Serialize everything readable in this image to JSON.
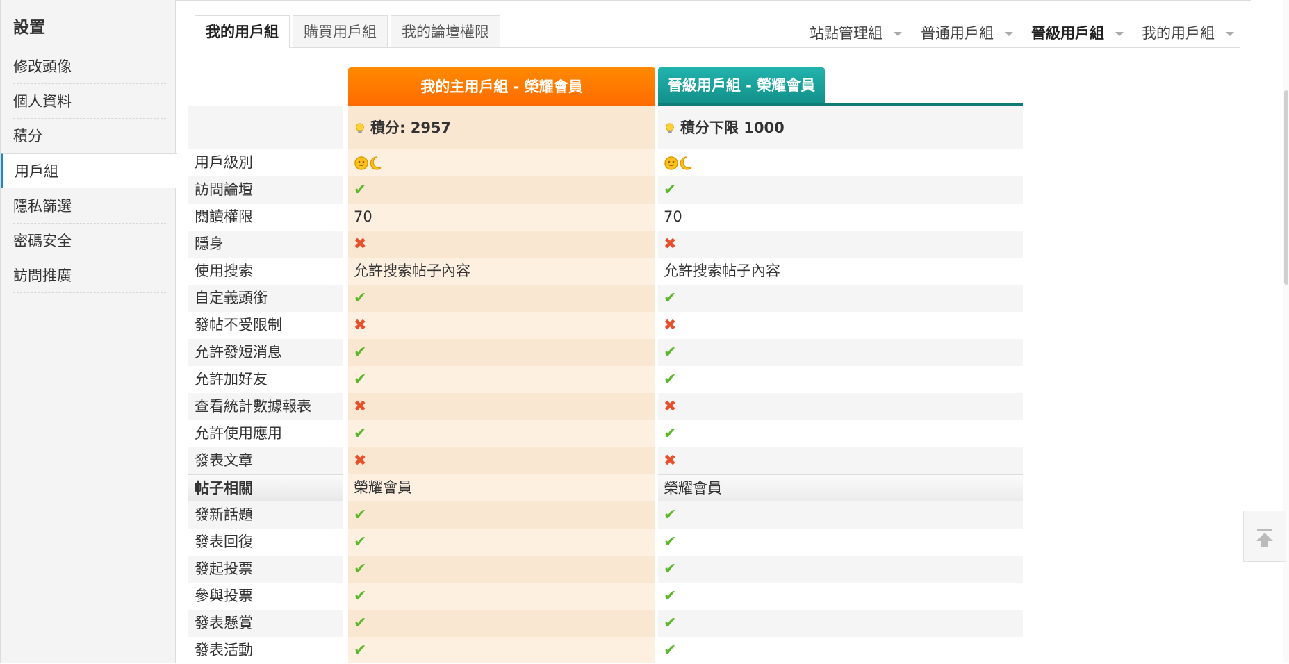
{
  "sidebar": {
    "title": "設置",
    "items": [
      {
        "label": "修改頭像"
      },
      {
        "label": "個人資料"
      },
      {
        "label": "積分"
      },
      {
        "label": "用戶組"
      },
      {
        "label": "隱私篩選"
      },
      {
        "label": "密碼安全"
      },
      {
        "label": "訪問推廣"
      }
    ]
  },
  "tabs": [
    {
      "label": "我的用戶組"
    },
    {
      "label": "購買用戶組"
    },
    {
      "label": "我的論壇權限"
    }
  ],
  "top_links": [
    {
      "label": "站點管理組"
    },
    {
      "label": "普通用戶組"
    },
    {
      "label": "晉級用戶組"
    },
    {
      "label": "我的用戶組"
    }
  ],
  "table": {
    "main_header": "我的主用戶組 - 榮耀會員",
    "alt_header": "晉級用戶組 - 榮耀會員",
    "main_score": "積分: 2957",
    "alt_score": "積分下限 1000",
    "rows": [
      {
        "label": "用戶級別",
        "c1": "icons",
        "c2": "icons"
      },
      {
        "label": "訪問論壇",
        "c1": "yes",
        "c2": "yes"
      },
      {
        "label": "閱讀權限",
        "c1": "70",
        "c2": "70"
      },
      {
        "label": "隱身",
        "c1": "no",
        "c2": "no"
      },
      {
        "label": "使用搜索",
        "c1": "允許搜索帖子內容",
        "c2": "允許搜索帖子內容"
      },
      {
        "label": "自定義頭銜",
        "c1": "yes",
        "c2": "yes"
      },
      {
        "label": "發帖不受限制",
        "c1": "no",
        "c2": "no"
      },
      {
        "label": "允許發短消息",
        "c1": "yes",
        "c2": "yes"
      },
      {
        "label": "允許加好友",
        "c1": "yes",
        "c2": "yes"
      },
      {
        "label": "查看統計數據報表",
        "c1": "no",
        "c2": "no"
      },
      {
        "label": "允許使用應用",
        "c1": "yes",
        "c2": "yes"
      },
      {
        "label": "發表文章",
        "c1": "no",
        "c2": "no"
      },
      {
        "label": "帖子相關",
        "c1": "榮耀會員",
        "c2": "榮耀會員",
        "section": true
      },
      {
        "label": "發新話題",
        "c1": "yes",
        "c2": "yes"
      },
      {
        "label": "發表回復",
        "c1": "yes",
        "c2": "yes"
      },
      {
        "label": "發起投票",
        "c1": "yes",
        "c2": "yes"
      },
      {
        "label": "參與投票",
        "c1": "yes",
        "c2": "yes"
      },
      {
        "label": "發表懸賞",
        "c1": "yes",
        "c2": "yes"
      },
      {
        "label": "發表活動",
        "c1": "yes",
        "c2": "yes"
      }
    ]
  },
  "colors": {
    "main_header": "#ff7a00",
    "alt_header": "#1a9f99",
    "check": "#5cb82a",
    "cross": "#e8502c",
    "active_accent": "#1e88c7"
  }
}
